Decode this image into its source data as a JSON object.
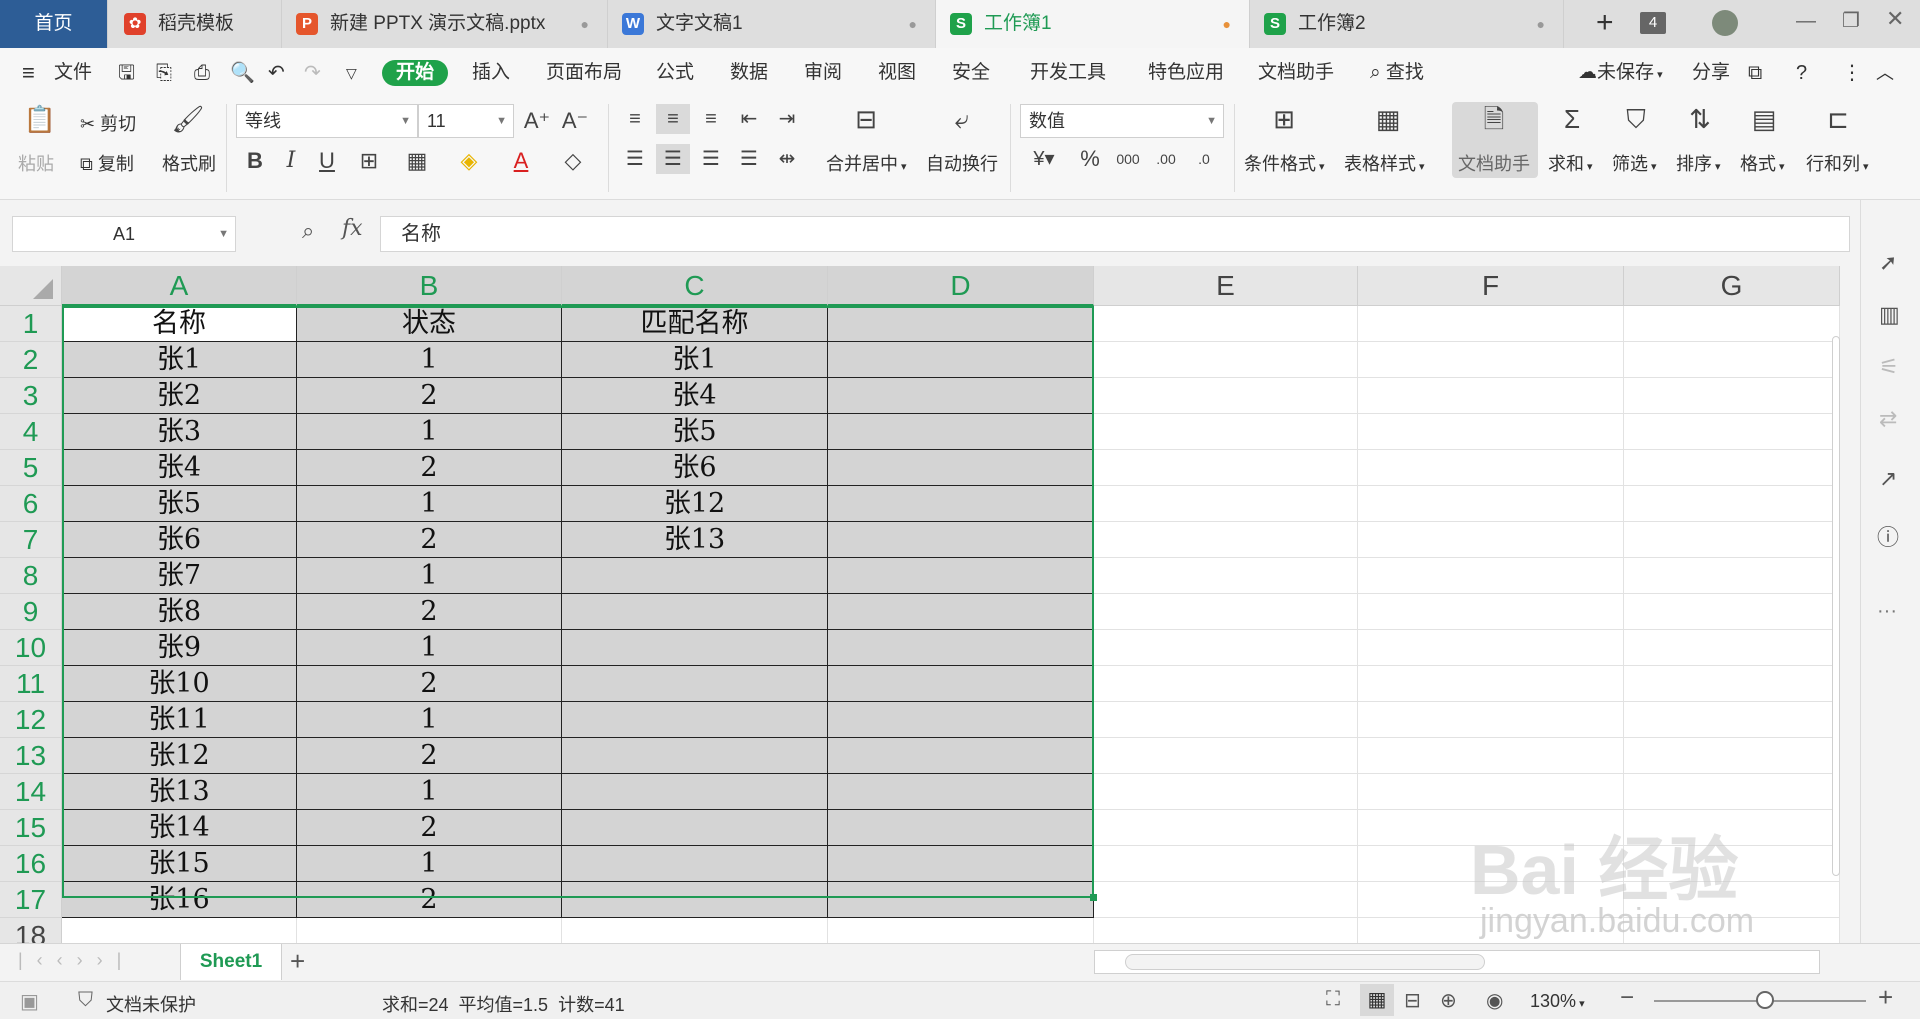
{
  "tabs": {
    "home": "首页",
    "t1": "稻壳模板",
    "t2": "新建 PPTX 演示文稿.pptx",
    "t3": "文字文稿1",
    "t4": "工作簿1",
    "t5": "工作簿2",
    "count": "4"
  },
  "menu": {
    "file": "文件",
    "start": "开始",
    "insert": "插入",
    "layout": "页面布局",
    "formula": "公式",
    "data": "数据",
    "review": "审阅",
    "view": "视图",
    "security": "安全",
    "dev": "开发工具",
    "special": "特色应用",
    "assistant": "文档助手",
    "search": "查找",
    "unsaved": "未保存",
    "share": "分享"
  },
  "ribbon": {
    "paste": "粘贴",
    "cut": "剪切",
    "copy": "复制",
    "format_painter": "格式刷",
    "font_name": "等线",
    "font_size": "11",
    "bold": "B",
    "italic": "I",
    "underline": "U",
    "merge_center": "合并居中",
    "wrap": "自动换行",
    "number_format": "数值",
    "cond_format": "条件格式",
    "table_style": "表格样式",
    "doc_assistant": "文档助手",
    "sum": "求和",
    "filter": "筛选",
    "sort": "排序",
    "format": "格式",
    "rowcol": "行和列"
  },
  "formula_bar": {
    "name_box": "A1",
    "fx": "fx",
    "content": "名称"
  },
  "sheet": {
    "columns": [
      "A",
      "B",
      "C",
      "D",
      "E",
      "F",
      "G"
    ],
    "rows": [
      "1",
      "2",
      "3",
      "4",
      "5",
      "6",
      "7",
      "8",
      "9",
      "10",
      "11",
      "12",
      "13",
      "14",
      "15",
      "16",
      "17",
      "18"
    ],
    "headers": [
      "名称",
      "状态",
      "匹配名称"
    ],
    "col_a": [
      "张1",
      "张2",
      "张3",
      "张4",
      "张5",
      "张6",
      "张7",
      "张8",
      "张9",
      "张10",
      "张11",
      "张12",
      "张13",
      "张14",
      "张15",
      "张16"
    ],
    "col_b": [
      "1",
      "2",
      "1",
      "2",
      "1",
      "2",
      "1",
      "2",
      "1",
      "2",
      "1",
      "2",
      "1",
      "2",
      "1",
      "2"
    ],
    "col_c": [
      "张1",
      "张4",
      "张5",
      "张6",
      "张12",
      "张13"
    ]
  },
  "sheet_tabs": {
    "active": "Sheet1",
    "add": "+"
  },
  "status": {
    "protect": "文档未保护",
    "stats": "求和=24  平均值=1.5  计数=41",
    "zoom": "130%"
  },
  "watermark": {
    "brand": "Bai 经验",
    "url": "jingyan.baidu.com"
  },
  "colors": {
    "accent": "#1f9a54",
    "home_tab": "#2d5d96"
  }
}
